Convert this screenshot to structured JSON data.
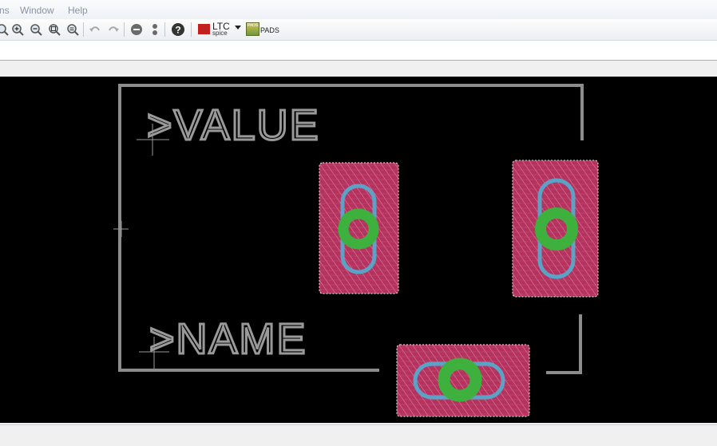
{
  "menubar": {
    "items": [
      {
        "label": "ns"
      },
      {
        "label": "Window"
      },
      {
        "label": "Help"
      }
    ]
  },
  "toolbar": {
    "icons": [
      "zoom-fit-icon",
      "zoom-in-icon",
      "zoom-out-icon",
      "zoom-select-icon",
      "zoom-previous-icon",
      "undo-icon",
      "redo-icon",
      "stop-icon",
      "go-icon",
      "help-icon"
    ],
    "ltc_label": "LTC",
    "ltc_sub": "spice",
    "pads_label": "PADS",
    "pads_logo_text": "PADS"
  },
  "canvas": {
    "value_text": ">VALUE",
    "name_text": ">NAME",
    "colors": {
      "background": "#000000",
      "outline": "#8c8c8c",
      "pad": "#b5325e",
      "via": "#3db03d",
      "drill_outline": "#5aa2c6"
    }
  }
}
